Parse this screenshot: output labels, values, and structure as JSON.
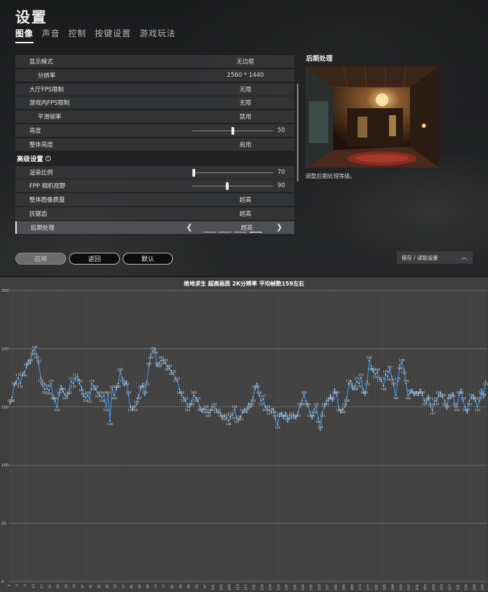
{
  "header": {
    "title": "设置",
    "tabs": [
      {
        "label": "图像",
        "active": true
      },
      {
        "label": "声音",
        "active": false
      },
      {
        "label": "控制",
        "active": false
      },
      {
        "label": "按键设置",
        "active": false
      },
      {
        "label": "游戏玩法",
        "active": false
      }
    ]
  },
  "settings": {
    "display_mode": {
      "label": "显示模式",
      "value": "无边框"
    },
    "resolution": {
      "label": "分辨率",
      "value": "2560 * 1440"
    },
    "lobby_fps": {
      "label": "大厅FPS限制",
      "value": "无限"
    },
    "ingame_fps": {
      "label": "游戏内FPS限制",
      "value": "无限"
    },
    "smooth_framerate": {
      "label": "平滑帧率",
      "value": "禁用"
    },
    "brightness": {
      "label": "亮度",
      "value": "50",
      "fraction": 0.5
    },
    "overall_brightness": {
      "label": "整体亮度",
      "value": "启用"
    },
    "advanced_header": "高级设置",
    "render_scale": {
      "label": "渲染比例",
      "value": "70",
      "fraction": 0.0
    },
    "fpp_fov": {
      "label": "FPP 相机视野",
      "value": "90",
      "fraction": 0.43
    },
    "overall_quality": {
      "label": "整体图像质量",
      "value": "超高"
    },
    "antialiasing": {
      "label": "抗锯齿",
      "value": "超高"
    },
    "post_processing": {
      "label": "后期处理",
      "value": "超高"
    }
  },
  "preview": {
    "title": "后期处理",
    "description": "调整后期处理等级。"
  },
  "buttons": {
    "apply": "应用",
    "back": "返回",
    "default": "默认",
    "save_load": "保存 / 读取设置"
  },
  "colors": {
    "line": "#3b8fe0",
    "chart_bg": "#3f3f3f",
    "grid": "#6a6a6a"
  },
  "chart_data": {
    "type": "line",
    "title": "绝地求生 超高画质 2K分辨率 平均帧数159左右",
    "xlabel": "",
    "ylabel": "",
    "ylim": [
      0,
      250
    ],
    "yticks": [
      0,
      50,
      100,
      150,
      200,
      250
    ],
    "grid": true,
    "series": [
      {
        "values": [
          153,
          158,
          168,
          172,
          175,
          170,
          177,
          180,
          184,
          190,
          188,
          198,
          199,
          195,
          187,
          175,
          168,
          165,
          166,
          164,
          170,
          160,
          155,
          150,
          160,
          168,
          163,
          160,
          159,
          165,
          172,
          170,
          175,
          176,
          170,
          167,
          159,
          158,
          160,
          157,
          170,
          168,
          165,
          162,
          160,
          158,
          160,
          150,
          160,
          138,
          165,
          160,
          165,
          170,
          180,
          175,
          168,
          172,
          160,
          150,
          148,
          150,
          152,
          160,
          165,
          170,
          160,
          172,
          185,
          195,
          198,
          199,
          185,
          188,
          190,
          190,
          188,
          185,
          183,
          181,
          178,
          175,
          172,
          165,
          160,
          158,
          155,
          150,
          150,
          155,
          160,
          158,
          155,
          150,
          146,
          148,
          148,
          145,
          145,
          150,
          150,
          148,
          145,
          145,
          140,
          142,
          141,
          138,
          142,
          143,
          148,
          140,
          139,
          142,
          145,
          148,
          146,
          153,
          150,
          158,
          165,
          170,
          160,
          155,
          157,
          150,
          148,
          147,
          146,
          148,
          140,
          135,
          142,
          145,
          140,
          145,
          137,
          143,
          142,
          143,
          140,
          145,
          150,
          155,
          160,
          155,
          150,
          145,
          140,
          148,
          150,
          140,
          130,
          145,
          150,
          155,
          155,
          160,
          155,
          165,
          160,
          150,
          145,
          148,
          150,
          158,
          170,
          172,
          165,
          168,
          172,
          170,
          175,
          165,
          160,
          172,
          190,
          185,
          180,
          178,
          180,
          175,
          172,
          168,
          178,
          176,
          182,
          176,
          168,
          160,
          172,
          186,
          188,
          182,
          170,
          160,
          162,
          165,
          160,
          163,
          160,
          165,
          160,
          155,
          154,
          160,
          150,
          147,
          155,
          155,
          160,
          162,
          158,
          155,
          148,
          160,
          158,
          162,
          150,
          150,
          160,
          165,
          155,
          150,
          145,
          155,
          158,
          160,
          155,
          150,
          155,
          165,
          158,
          172
        ]
      }
    ]
  }
}
